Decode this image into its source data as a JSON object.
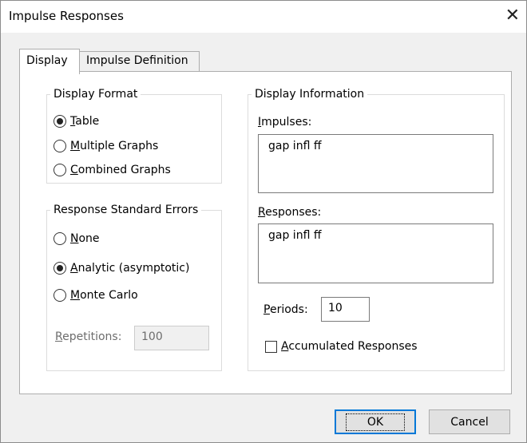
{
  "window": {
    "title": "Impulse Responses",
    "close_glyph": "✕"
  },
  "tabs": [
    {
      "label": "Display",
      "active": true
    },
    {
      "label": "Impulse Definition",
      "active": false
    }
  ],
  "display_format": {
    "legend": "Display Format",
    "options": [
      {
        "label": "Table",
        "underline": "T",
        "rest": "able",
        "selected": true
      },
      {
        "label": "Multiple Graphs",
        "underline": "M",
        "rest": "ultiple Graphs",
        "selected": false
      },
      {
        "label": "Combined Graphs",
        "underline": "C",
        "rest": "ombined Graphs",
        "selected": false
      }
    ]
  },
  "standard_errors": {
    "legend": "Response Standard Errors",
    "options": [
      {
        "label": "None",
        "underline": "N",
        "rest": "one",
        "selected": false
      },
      {
        "label": "Analytic (asymptotic)",
        "underline": "A",
        "rest": "nalytic (asymptotic)",
        "selected": true
      },
      {
        "label": "Monte Carlo",
        "underline": "M",
        "rest": "onte Carlo",
        "selected": false
      }
    ],
    "repetitions": {
      "label_ul": "R",
      "label_rest": "epetitions:",
      "value": "100",
      "disabled": true
    }
  },
  "display_information": {
    "legend": "Display Information",
    "impulses": {
      "label_ul": "I",
      "label_rest": "mpulses:",
      "value": "gap infl ff"
    },
    "responses": {
      "label_ul": "R",
      "label_rest": "esponses:",
      "value": "gap infl ff"
    },
    "periods": {
      "label_ul": "P",
      "label_rest": "eriods:",
      "value": "10"
    },
    "accumulated": {
      "label_ul": "A",
      "label_rest": "ccumulated Responses",
      "checked": false
    }
  },
  "buttons": {
    "ok": "OK",
    "cancel": "Cancel"
  }
}
